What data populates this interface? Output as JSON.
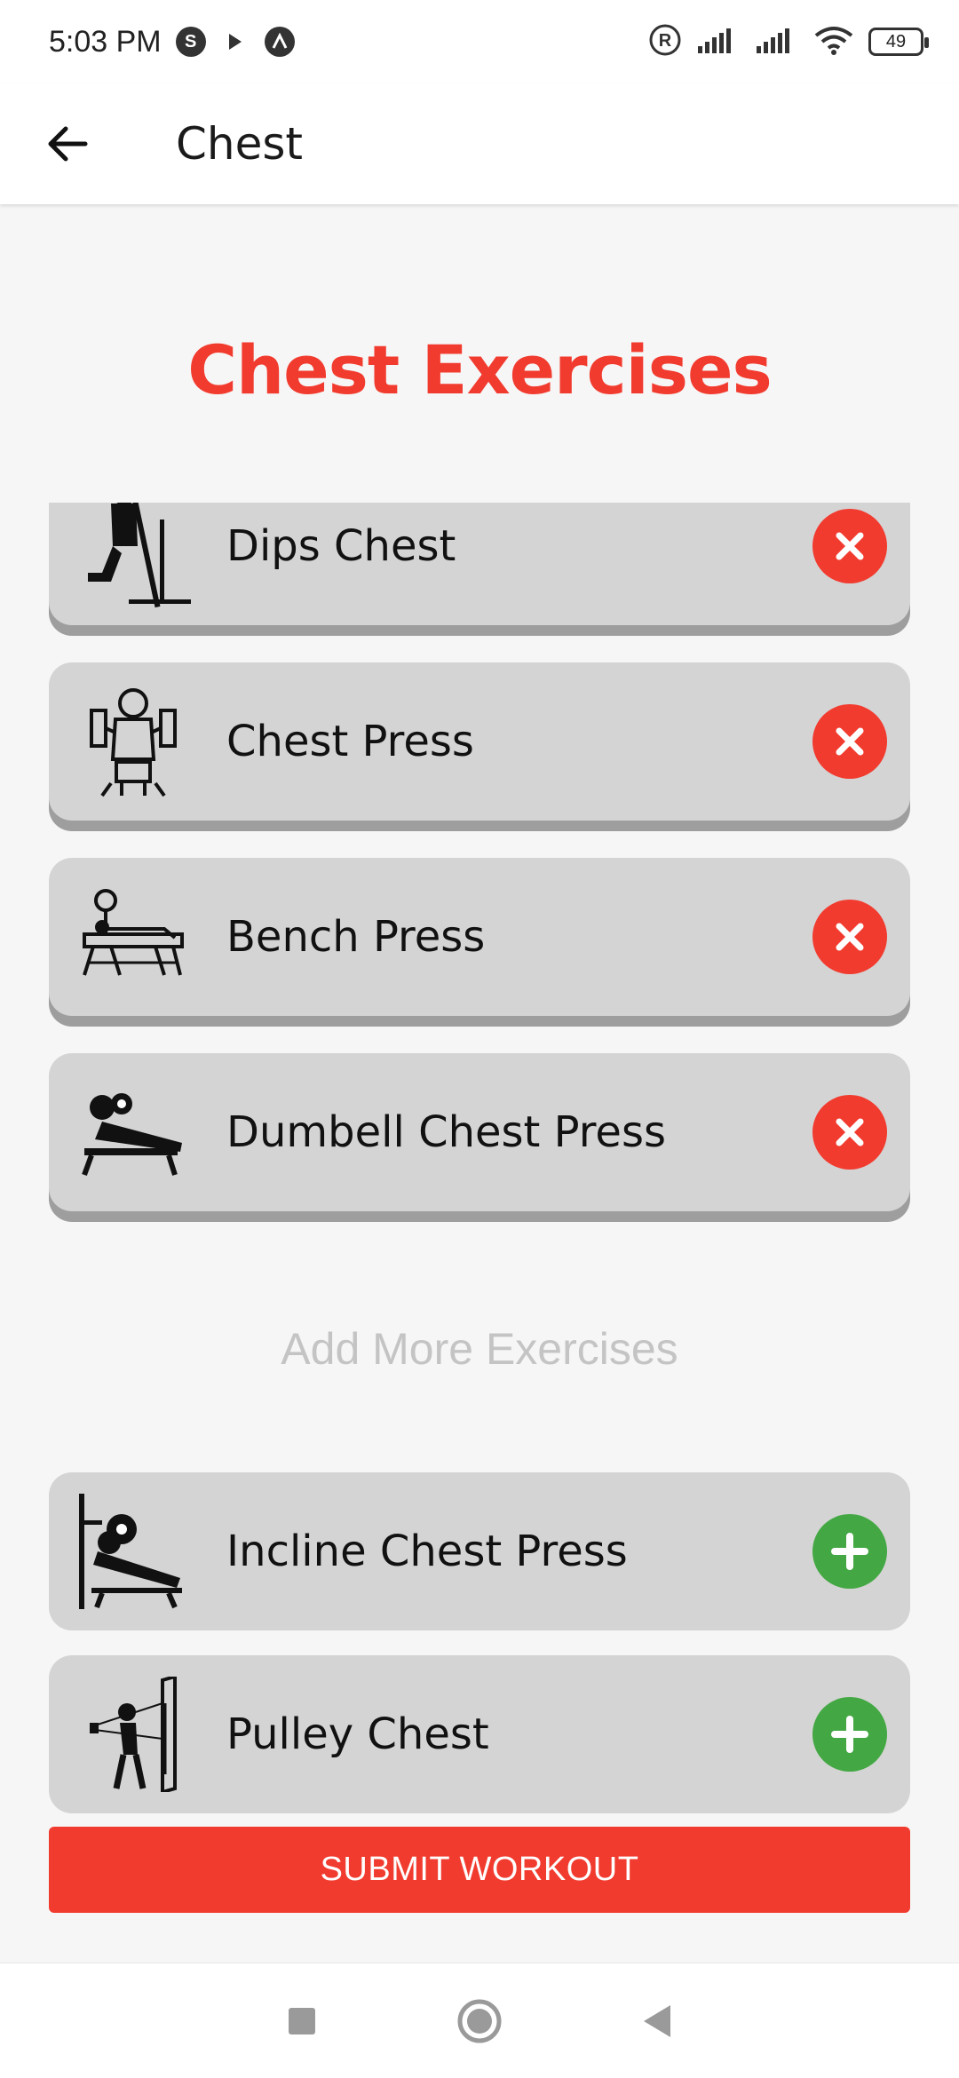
{
  "status_bar": {
    "time": "5:03 PM",
    "badge_s": "S",
    "battery_level": "49"
  },
  "app_bar": {
    "title": "Chest"
  },
  "heading": "Chest Exercises",
  "selected_exercises": [
    {
      "label": "Dips Chest",
      "icon": "dips-chest-icon"
    },
    {
      "label": "Chest Press",
      "icon": "chest-press-icon"
    },
    {
      "label": "Bench Press",
      "icon": "bench-press-icon"
    },
    {
      "label": "Dumbell Chest Press",
      "icon": "dumbbell-chest-press-icon"
    }
  ],
  "add_more_label": "Add More Exercises",
  "more_exercises": [
    {
      "label": "Incline Chest Press",
      "icon": "incline-chest-press-icon"
    },
    {
      "label": "Pulley Chest",
      "icon": "pulley-chest-icon"
    }
  ],
  "submit_label": "SUBMIT WORKOUT",
  "colors": {
    "accent": "#f23b2f",
    "add": "#43a843",
    "card": "#d4d4d4"
  }
}
